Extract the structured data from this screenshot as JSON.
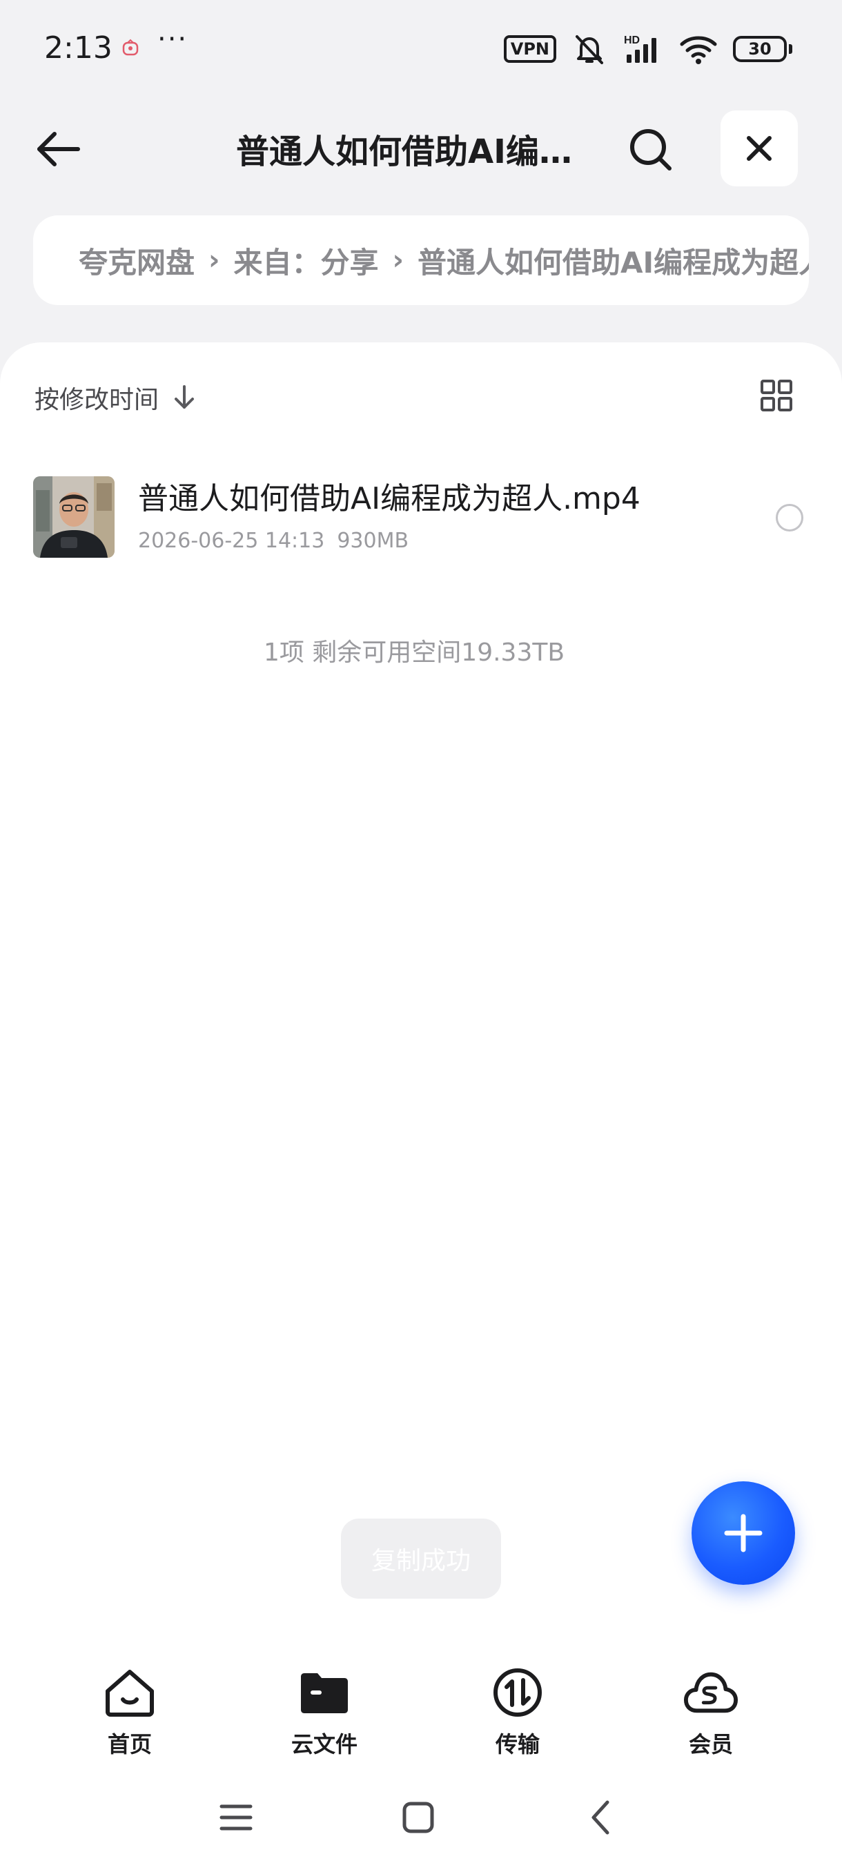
{
  "status_bar": {
    "time": "2:13",
    "more": "···",
    "vpn": "VPN",
    "hd": "HD",
    "battery": "30"
  },
  "header": {
    "title": "普通人如何借助AI编…"
  },
  "breadcrumb": {
    "items": [
      "夸克网盘",
      "来自：分享",
      "普通人如何借助AI编程成为超人"
    ]
  },
  "sort": {
    "label": "按修改时间"
  },
  "files": [
    {
      "name": "普通人如何借助AI编程成为超人.mp4",
      "date": "2026-06-25 14:13",
      "size": "930MB"
    }
  ],
  "summary": "1项 剩余可用空间19.33TB",
  "toast": "复制成功",
  "bottom_nav": {
    "items": [
      {
        "label": "首页",
        "icon": "home-icon"
      },
      {
        "label": "云文件",
        "icon": "folder-icon"
      },
      {
        "label": "传输",
        "icon": "transfer-icon"
      },
      {
        "label": "会员",
        "icon": "member-cloud-icon"
      }
    ]
  },
  "colors": {
    "accent": "#1a5cff",
    "background": "#f2f2f4",
    "text_primary": "#1c1c1e",
    "text_secondary": "#9a9a9e"
  }
}
